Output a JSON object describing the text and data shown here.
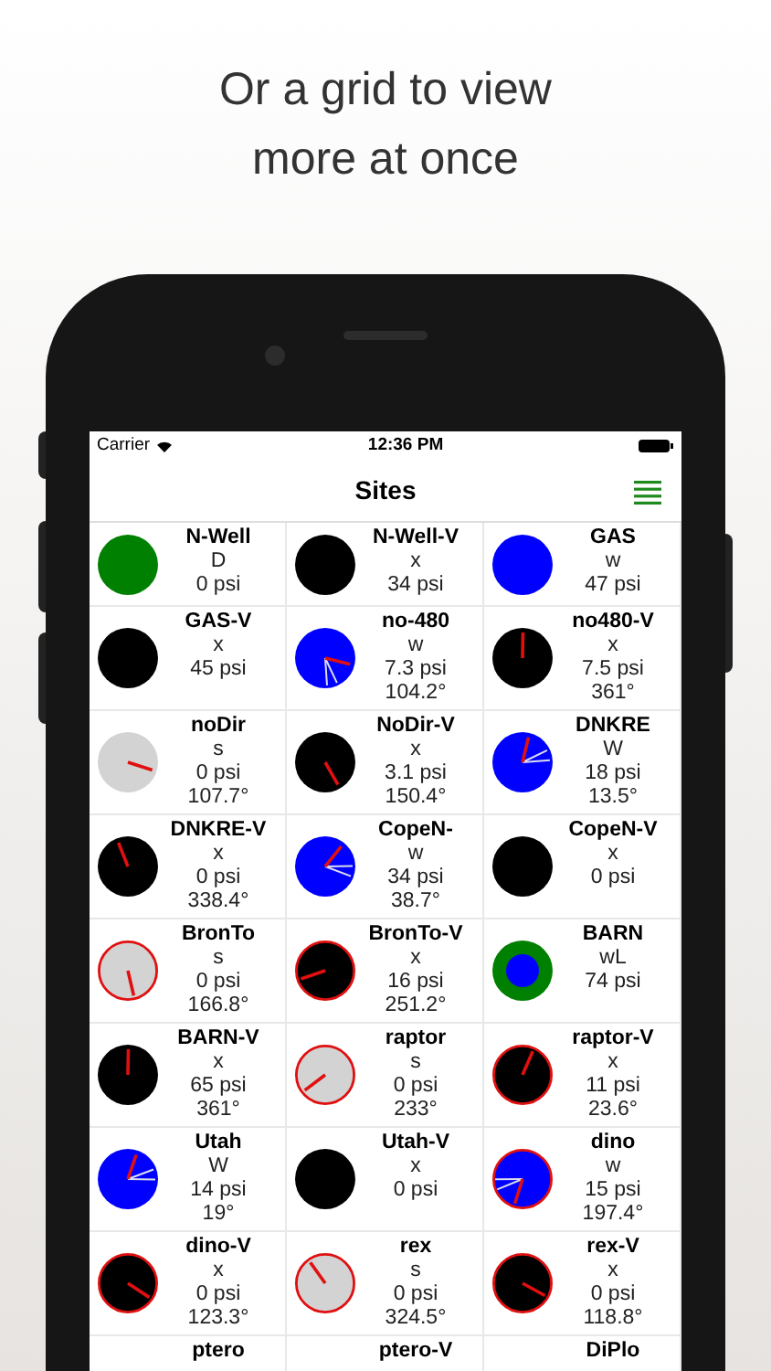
{
  "headline": [
    "Or a grid to view",
    "more at once"
  ],
  "status_bar": {
    "carrier": "Carrier",
    "time": "12:36 PM"
  },
  "nav": {
    "title": "Sites"
  },
  "sites": [
    {
      "name": "N-Well",
      "mode": "D",
      "pressure": "0 psi",
      "gauge": {
        "color": "#008000",
        "ring": false
      }
    },
    {
      "name": "N-Well-V",
      "mode": "x",
      "pressure": "34 psi",
      "gauge": {
        "color": "#000000",
        "ring": false
      }
    },
    {
      "name": "GAS",
      "mode": "w",
      "pressure": "47 psi",
      "gauge": {
        "color": "#0000ff",
        "ring": false
      }
    },
    {
      "name": "GAS-V",
      "mode": "x",
      "pressure": "45 psi",
      "gauge": {
        "color": "#000000",
        "ring": false
      }
    },
    {
      "name": "no-480",
      "mode": "w",
      "pressure": "7.3 psi",
      "heading": "104.2°",
      "gauge": {
        "kind": "wind",
        "color": "#0000ff",
        "ring": false
      }
    },
    {
      "name": "no480-V",
      "mode": "x",
      "pressure": "7.5 psi",
      "heading": "361°",
      "gauge": {
        "kind": "dial",
        "color": "#000000",
        "ring": false
      }
    },
    {
      "name": "noDir",
      "mode": "s",
      "pressure": "0 psi",
      "heading": "107.7°",
      "gauge": {
        "kind": "dial",
        "color": "#d3d3d3",
        "ring": false
      }
    },
    {
      "name": "NoDir-V",
      "mode": "x",
      "pressure": "3.1 psi",
      "heading": "150.4°",
      "gauge": {
        "kind": "dial",
        "color": "#000000",
        "ring": false
      }
    },
    {
      "name": "DNKRE",
      "mode": "W",
      "pressure": "18 psi",
      "heading": "13.5°",
      "gauge": {
        "kind": "wind",
        "color": "#0000ff",
        "ring": false
      }
    },
    {
      "name": "DNKRE-V",
      "mode": "x",
      "pressure": "0 psi",
      "heading": "338.4°",
      "gauge": {
        "kind": "dial",
        "color": "#000000",
        "ring": false
      }
    },
    {
      "name": "CopeN-",
      "mode": "w",
      "pressure": "34 psi",
      "heading": "38.7°",
      "gauge": {
        "kind": "wind",
        "color": "#0000ff",
        "ring": false
      }
    },
    {
      "name": "CopeN-V",
      "mode": "x",
      "pressure": "0 psi",
      "gauge": {
        "color": "#000000",
        "ring": false
      }
    },
    {
      "name": "BronTo",
      "mode": "s",
      "pressure": "0 psi",
      "heading": "166.8°",
      "gauge": {
        "kind": "dial",
        "color": "#d3d3d3",
        "ring": true
      }
    },
    {
      "name": "BronTo-V",
      "mode": "x",
      "pressure": "16 psi",
      "heading": "251.2°",
      "gauge": {
        "kind": "dial",
        "color": "#000000",
        "ring": true
      }
    },
    {
      "name": "BARN",
      "mode": "wL",
      "pressure": "74 psi",
      "gauge": {
        "color": "#008000",
        "ring": false,
        "core": {
          "color": "#0000ff"
        }
      }
    },
    {
      "name": "BARN-V",
      "mode": "x",
      "pressure": "65 psi",
      "heading": "361°",
      "gauge": {
        "kind": "dial",
        "color": "#000000",
        "ring": false
      }
    },
    {
      "name": "raptor",
      "mode": "s",
      "pressure": "0 psi",
      "heading": "233°",
      "gauge": {
        "kind": "dial",
        "color": "#d3d3d3",
        "ring": true
      }
    },
    {
      "name": "raptor-V",
      "mode": "x",
      "pressure": "11 psi",
      "heading": "23.6°",
      "gauge": {
        "kind": "dial",
        "color": "#000000",
        "ring": true
      }
    },
    {
      "name": "Utah",
      "mode": "W",
      "pressure": "14 psi",
      "heading": "19°",
      "gauge": {
        "kind": "wind",
        "color": "#0000ff",
        "ring": false
      }
    },
    {
      "name": "Utah-V",
      "mode": "x",
      "pressure": "0 psi",
      "gauge": {
        "color": "#000000",
        "ring": false
      }
    },
    {
      "name": "dino",
      "mode": "w",
      "pressure": "15 psi",
      "heading": "197.4°",
      "gauge": {
        "kind": "wind",
        "color": "#0000ff",
        "ring": true
      }
    },
    {
      "name": "dino-V",
      "mode": "x",
      "pressure": "0 psi",
      "heading": "123.3°",
      "gauge": {
        "kind": "dial",
        "color": "#000000",
        "ring": true
      }
    },
    {
      "name": "rex",
      "mode": "s",
      "pressure": "0 psi",
      "heading": "324.5°",
      "gauge": {
        "kind": "dial",
        "color": "#d3d3d3",
        "ring": true
      }
    },
    {
      "name": "rex-V",
      "mode": "x",
      "pressure": "0 psi",
      "heading": "118.8°",
      "gauge": {
        "kind": "dial",
        "color": "#000000",
        "ring": true
      }
    },
    {
      "name": "ptero"
    },
    {
      "name": "ptero-V"
    },
    {
      "name": "DiPlo"
    }
  ]
}
